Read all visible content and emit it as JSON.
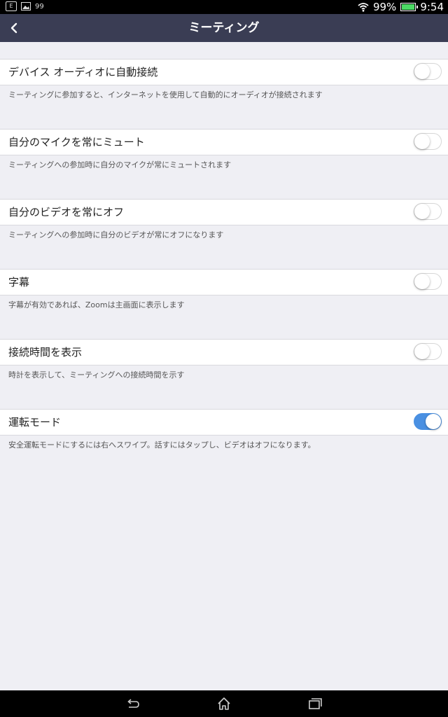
{
  "status_bar": {
    "left_icon_text": "E",
    "small_text": "99",
    "battery_percent": "99%",
    "time": "9:54",
    "battery_level": 0.99
  },
  "header": {
    "title": "ミーティング"
  },
  "settings": [
    {
      "label": "デバイス オーディオに自動接続",
      "description": "ミーティングに参加すると、インターネットを使用して自動的にオーディオが接続されます",
      "enabled": false
    },
    {
      "label": "自分のマイクを常にミュート",
      "description": "ミーティングへの参加時に自分のマイクが常にミュートされます",
      "enabled": false
    },
    {
      "label": "自分のビデオを常にオフ",
      "description": "ミーティングへの参加時に自分のビデオが常にオフになります",
      "enabled": false
    },
    {
      "label": "字幕",
      "description": "字幕が有効であれば、Zoomは主画面に表示します",
      "enabled": false
    },
    {
      "label": "接続時間を表示",
      "description": "時計を表示して、ミーティングへの接続時間を示す",
      "enabled": false
    },
    {
      "label": "運転モード",
      "description": "安全運転モードにするには右へスワイプ。話すにはタップし、ビデオはオフになります。",
      "enabled": true
    }
  ],
  "colors": {
    "header_bg": "#3a3d54",
    "toggle_on": "#4a90e2",
    "page_bg": "#efeff4"
  },
  "icons": {
    "back": "chevron-left-icon",
    "wifi": "wifi-icon",
    "battery": "battery-icon",
    "nav_back": "back-arrow-icon",
    "nav_home": "home-icon",
    "nav_recent": "recent-apps-icon"
  }
}
